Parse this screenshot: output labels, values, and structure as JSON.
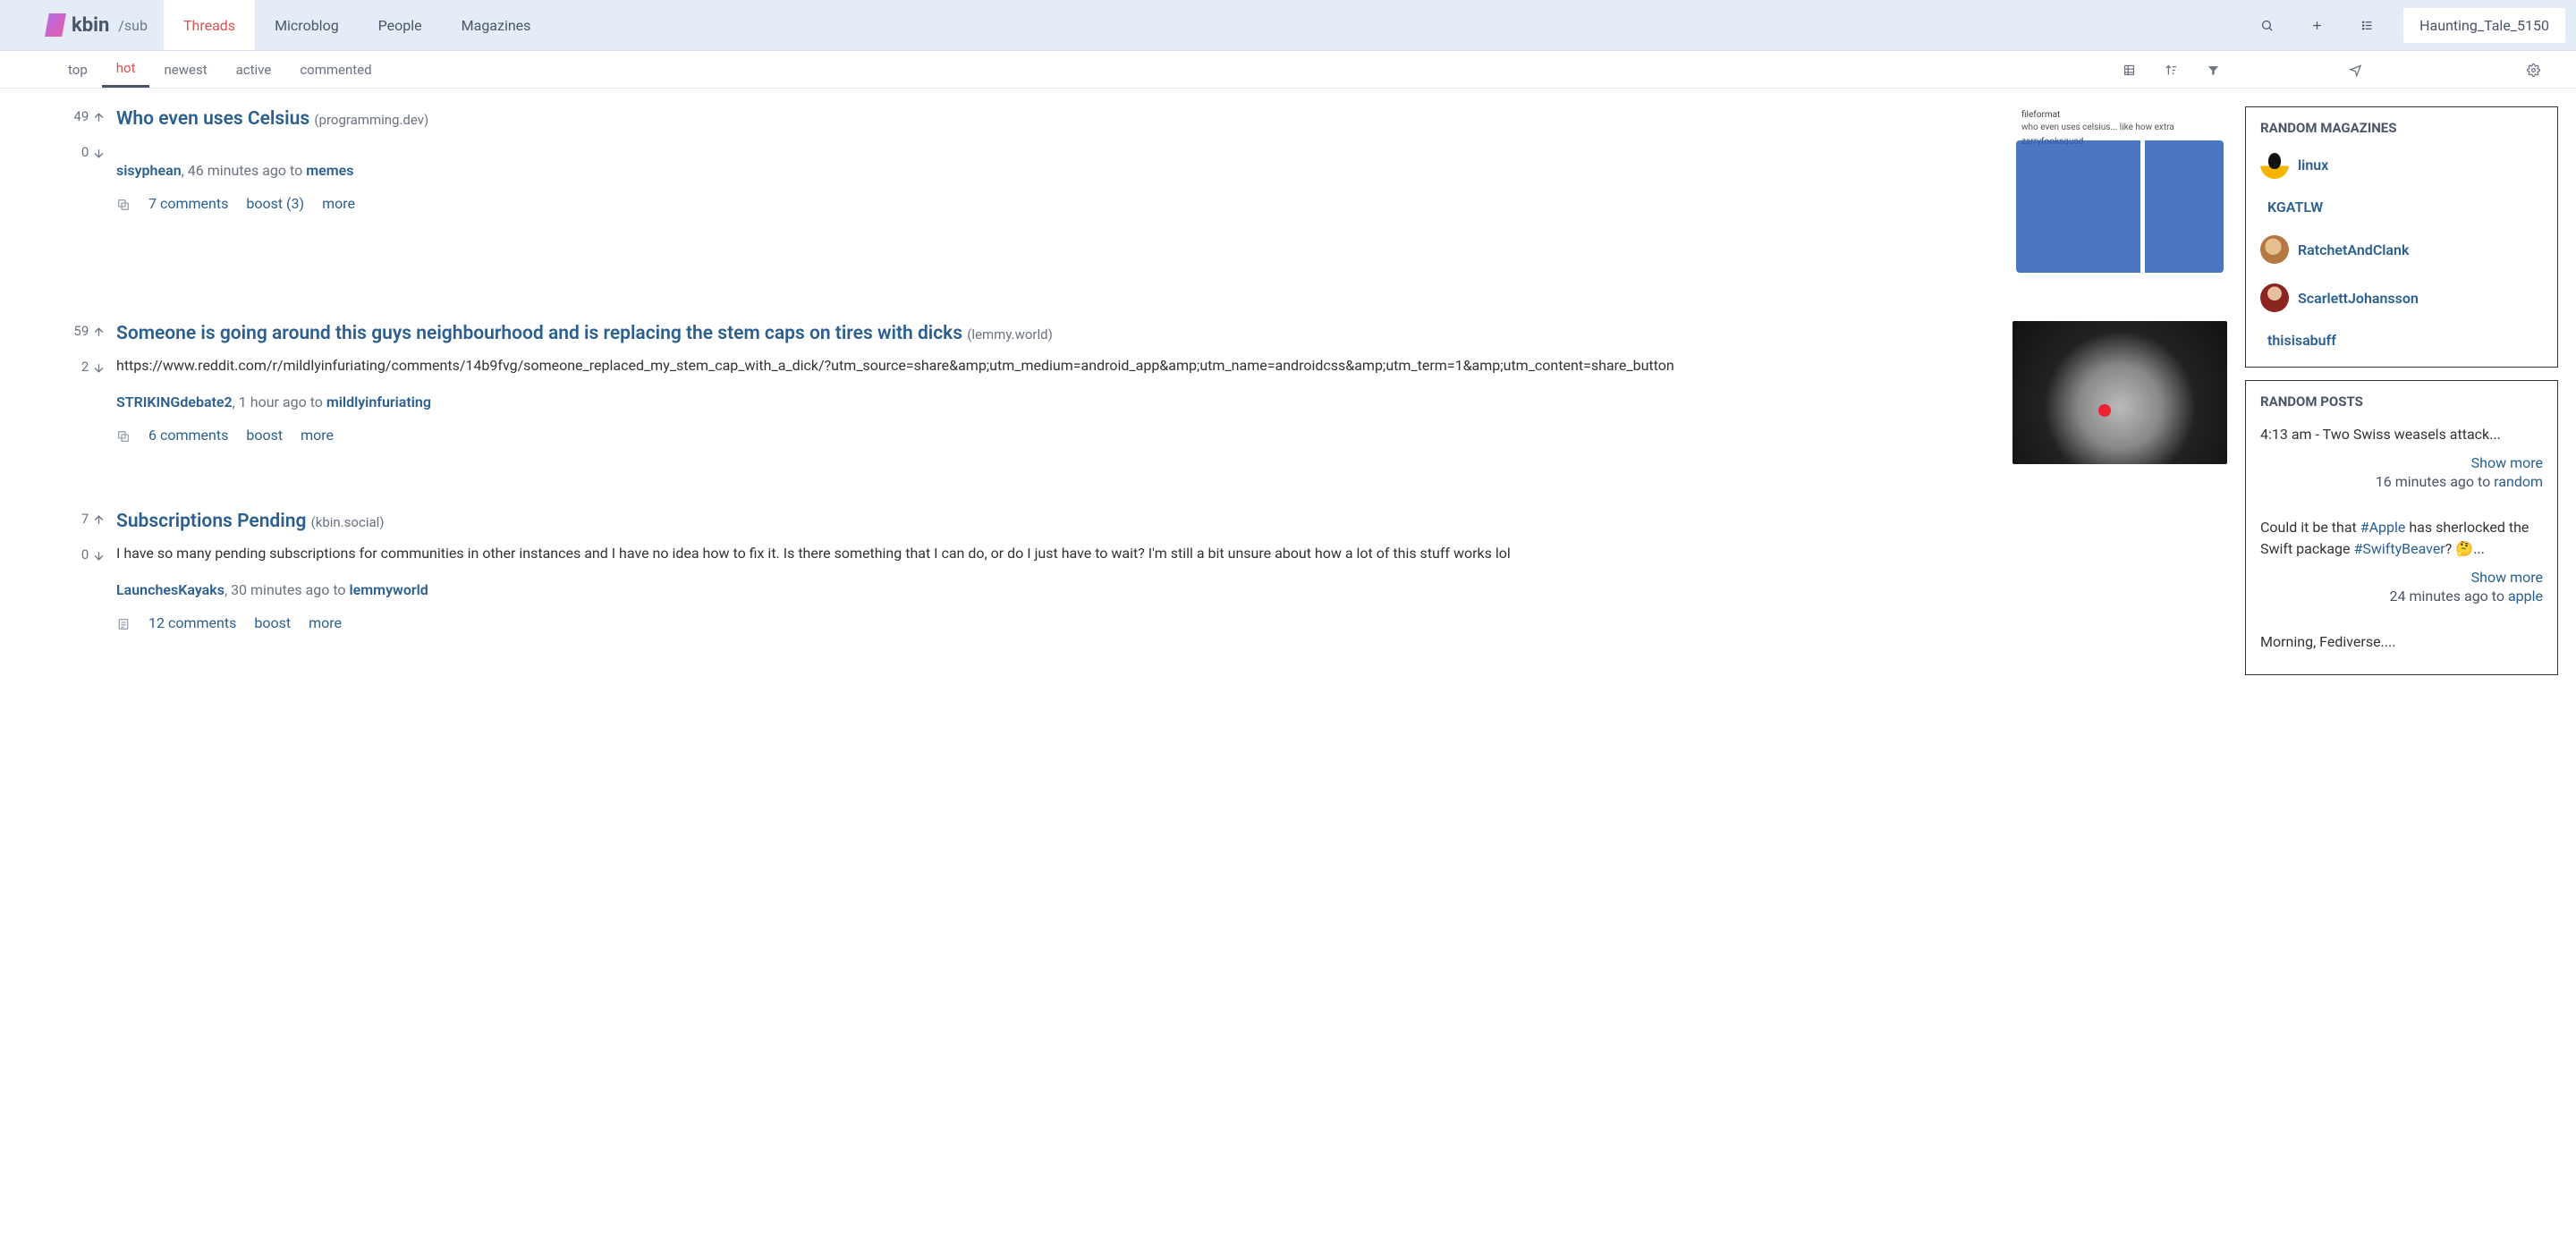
{
  "header": {
    "brand": "kbin",
    "sub": "/sub",
    "tabs": [
      "Threads",
      "Microblog",
      "People",
      "Magazines"
    ],
    "active_tab": 0,
    "username": "Haunting_Tale_5150"
  },
  "sort": {
    "items": [
      "top",
      "hot",
      "newest",
      "active",
      "commented"
    ],
    "active": 1
  },
  "posts": [
    {
      "upvotes": "49",
      "downvotes": "0",
      "title": "Who even uses Celsius",
      "domain": "(programming.dev)",
      "author": "sisyphean",
      "time": "46 minutes ago",
      "to": "to",
      "magazine": "memes",
      "comments": "7 comments",
      "boost": "boost (3)",
      "more": "more",
      "thumb_caption_user": "fileformat",
      "thumb_caption_text": "who even uses celsius... like how extra",
      "thumb_caption_user2": "zarryfooksquad"
    },
    {
      "upvotes": "59",
      "downvotes": "2",
      "title": "Someone is going around this guys neighbourhood and is replacing the stem caps on tires with dicks",
      "domain": "(lemmy.world)",
      "body_url": "https://www.reddit.com/r/mildlyinfuriating/comments/14b9fvg/someone_replaced_my_stem_cap_with_a_dick/?utm_source=share&amp;utm_medium=android_app&amp;utm_name=androidcss&amp;utm_term=1&amp;utm_content=share_button",
      "author": "STRIKINGdebate2",
      "time": "1 hour ago",
      "to": "to",
      "magazine": "mildlyinfuriating",
      "comments": "6 comments",
      "boost": "boost",
      "more": "more"
    },
    {
      "upvotes": "7",
      "downvotes": "0",
      "title": "Subscriptions Pending",
      "domain": "(kbin.social)",
      "body_text": "I have so many pending subscriptions for communities in other instances and I have no idea how to fix it. Is there something that I can do, or do I just have to wait? I'm still a bit unsure about how a lot of this stuff works lol",
      "author": "LaunchesKayaks",
      "time": "30 minutes ago",
      "to": "to",
      "magazine": "lemmyworld",
      "comments": "12 comments",
      "boost": "boost",
      "more": "more"
    }
  ],
  "sidebar": {
    "random_magazines_title": "RANDOM MAGAZINES",
    "magazines": [
      {
        "name": "linux",
        "avatar": "linux"
      },
      {
        "name": "KGATLW",
        "avatar": null
      },
      {
        "name": "RatchetAndClank",
        "avatar": "rc"
      },
      {
        "name": "ScarlettJohansson",
        "avatar": "sj"
      },
      {
        "name": "thisisabuff",
        "avatar": null
      }
    ],
    "random_posts_title": "RANDOM POSTS",
    "random_posts": [
      {
        "text_pre": "4:13 am - Two Swiss weasels attack...",
        "show_more": "Show more",
        "meta_time": "16 minutes ago to",
        "meta_mag": "random"
      },
      {
        "text_pre": "Could it be that ",
        "hashtag1": "#Apple",
        "text_mid": " has sherlocked the Swift package ",
        "hashtag2": "#SwiftyBeaver",
        "text_post": "? 🤔...",
        "show_more": "Show more",
        "meta_time": "24 minutes ago to",
        "meta_mag": "apple"
      },
      {
        "text_pre": "Morning, Fediverse...."
      }
    ]
  },
  "labels": {
    "comma_sep": ", "
  }
}
